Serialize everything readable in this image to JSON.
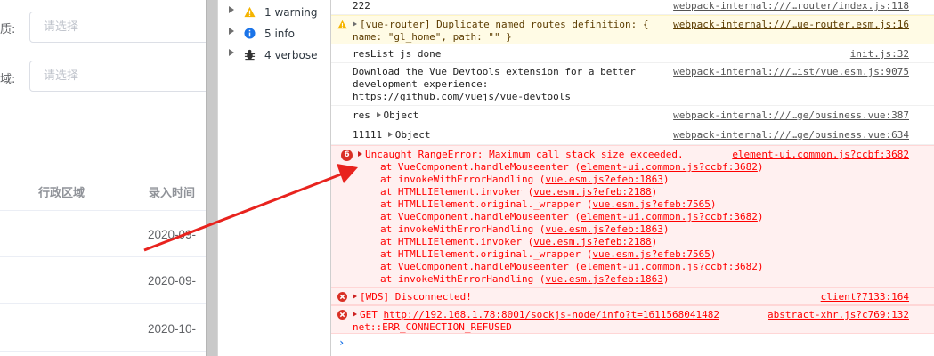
{
  "webapp": {
    "form": [
      {
        "label": "质:",
        "placeholder": "请选择"
      },
      {
        "label": "域:",
        "placeholder": "请选择"
      }
    ],
    "table": {
      "headers": [
        "行政区域",
        "录入时间"
      ],
      "dates": [
        "2020-09-",
        "2020-09-",
        "2020-10-"
      ]
    }
  },
  "devtools": {
    "sidebar": [
      {
        "label": "1 warning",
        "icon": "warning-icon"
      },
      {
        "label": "5 info",
        "icon": "info-icon"
      },
      {
        "label": "4 verbose",
        "icon": "bug-icon"
      }
    ],
    "console": {
      "messages": {
        "m222": {
          "text": "222",
          "source": "webpack-internal:///…router/index.js:118"
        },
        "warn": {
          "line1": "[vue-router] Duplicate named routes definition: {",
          "line2": "name: \"gl_home\", path: \"\" }",
          "source": "webpack-internal:///…ue-router.esm.js:16"
        },
        "reslist": {
          "text": "resList js done",
          "source": "init.js:32"
        },
        "devtools": {
          "line1": "Download the Vue Devtools extension for a better",
          "line2": "development experience:",
          "link": "https://github.com/vuejs/vue-devtools",
          "source": "webpack-internal:///…ist/vue.esm.js:9075"
        },
        "res": {
          "prefix": "res",
          "object": "Object",
          "source": "webpack-internal:///…ge/business.vue:387"
        },
        "n11111": {
          "prefix": "11111",
          "object": "Object",
          "source": "webpack-internal:///…ge/business.vue:634"
        },
        "range_error": {
          "count": "6",
          "title": "Uncaught RangeError: Maximum call stack size exceeded.",
          "source": "element-ui.common.js?ccbf:3682",
          "stack": [
            {
              "fn": "at VueComponent.handleMouseenter (",
              "loc": "element-ui.common.js?ccbf:3682",
              "end": ")"
            },
            {
              "fn": "at invokeWithErrorHandling (",
              "loc": "vue.esm.js?efeb:1863",
              "end": ")"
            },
            {
              "fn": "at HTMLLIElement.invoker (",
              "loc": "vue.esm.js?efeb:2188",
              "end": ")"
            },
            {
              "fn": "at HTMLLIElement.original._wrapper (",
              "loc": "vue.esm.js?efeb:7565",
              "end": ")"
            },
            {
              "fn": "at VueComponent.handleMouseenter (",
              "loc": "element-ui.common.js?ccbf:3682",
              "end": ")"
            },
            {
              "fn": "at invokeWithErrorHandling (",
              "loc": "vue.esm.js?efeb:1863",
              "end": ")"
            },
            {
              "fn": "at HTMLLIElement.invoker (",
              "loc": "vue.esm.js?efeb:2188",
              "end": ")"
            },
            {
              "fn": "at HTMLLIElement.original._wrapper (",
              "loc": "vue.esm.js?efeb:7565",
              "end": ")"
            },
            {
              "fn": "at VueComponent.handleMouseenter (",
              "loc": "element-ui.common.js?ccbf:3682",
              "end": ")"
            },
            {
              "fn": "at invokeWithErrorHandling (",
              "loc": "vue.esm.js?efeb:1863",
              "end": ")"
            }
          ]
        },
        "wds": {
          "text": "[WDS] Disconnected!",
          "source": "client?7133:164"
        },
        "get": {
          "method": "GET",
          "url": "http://192.168.1.78:8001/sockjs-node/info?t=1611568041482",
          "line2": "net::ERR_CONNECTION_REFUSED",
          "source": "abstract-xhr.js?c769:132"
        }
      }
    }
  },
  "colors": {
    "error": "#ff0000",
    "warning": "#f5b400",
    "info": "#1a73e8",
    "arrow": "#e8231e"
  }
}
